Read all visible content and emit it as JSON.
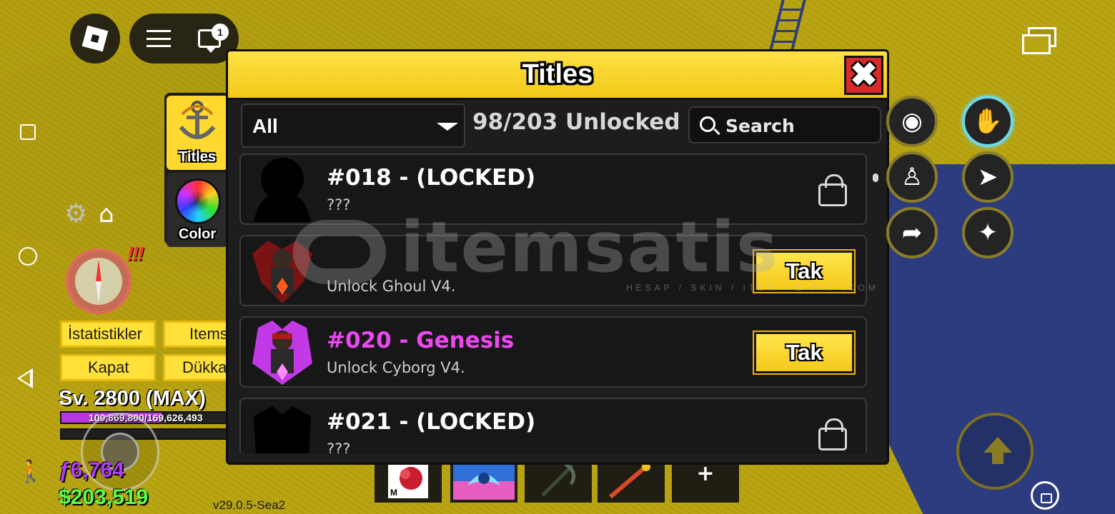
{
  "dialog": {
    "title": "Titles",
    "filter": {
      "selected": "All"
    },
    "unlocked_count": "98/203 Unlocked",
    "search": {
      "placeholder": "Search"
    },
    "rows": [
      {
        "name": "#018 - (LOCKED)",
        "desc": "???",
        "state": "locked",
        "name_color": "#ffffff",
        "icon": "locked-silhouette-icon"
      },
      {
        "name": "",
        "desc": "Unlock Ghoul V4.",
        "state": "equip",
        "button": "Tak",
        "icon": "ghoul-avatar-icon"
      },
      {
        "name": "#020 - Genesis",
        "desc": "Unlock Cyborg V4.",
        "state": "equip",
        "button": "Tak",
        "name_color": "#ec48f0",
        "icon": "cyborg-avatar-icon"
      },
      {
        "name": "#021 - (LOCKED)",
        "desc": "???",
        "state": "locked",
        "name_color": "#ffffff",
        "icon": "locked-silhouette-icon"
      }
    ]
  },
  "side_tabs": [
    {
      "label": "Titles",
      "icon": "anchor-icon",
      "selected": true
    },
    {
      "label": "Color",
      "icon": "color-wheel-icon",
      "selected": false
    }
  ],
  "hud": {
    "chat_badge": "1",
    "buttons": {
      "stats": "İstatistikler",
      "items": "Items",
      "close": "Kapat",
      "shop": "Dükkan"
    },
    "alert": "!!!",
    "level": "Sv. 2800 (MAX)",
    "xp_text": "100,869,800/169,626,493",
    "xp_fraction": 0.595,
    "fragments": "ƒ6,764",
    "money": "$203,519",
    "version": "v29.0.5-Sea2"
  },
  "watermark": {
    "text": "itemsatis",
    "subtext": "HESAP / SKIN / ITEM / E-PIN .COM"
  },
  "right_hud": {
    "skills": [
      "eye-icon",
      "haki-icon",
      "muscle-icon",
      "dash-icon",
      "sprint-icon",
      "flame-fist-icon"
    ]
  },
  "colors": {
    "accent": "#ffd930",
    "dialog_bg": "#1d1d1d",
    "close": "#d72a2a",
    "genesis": "#ec48f0"
  }
}
